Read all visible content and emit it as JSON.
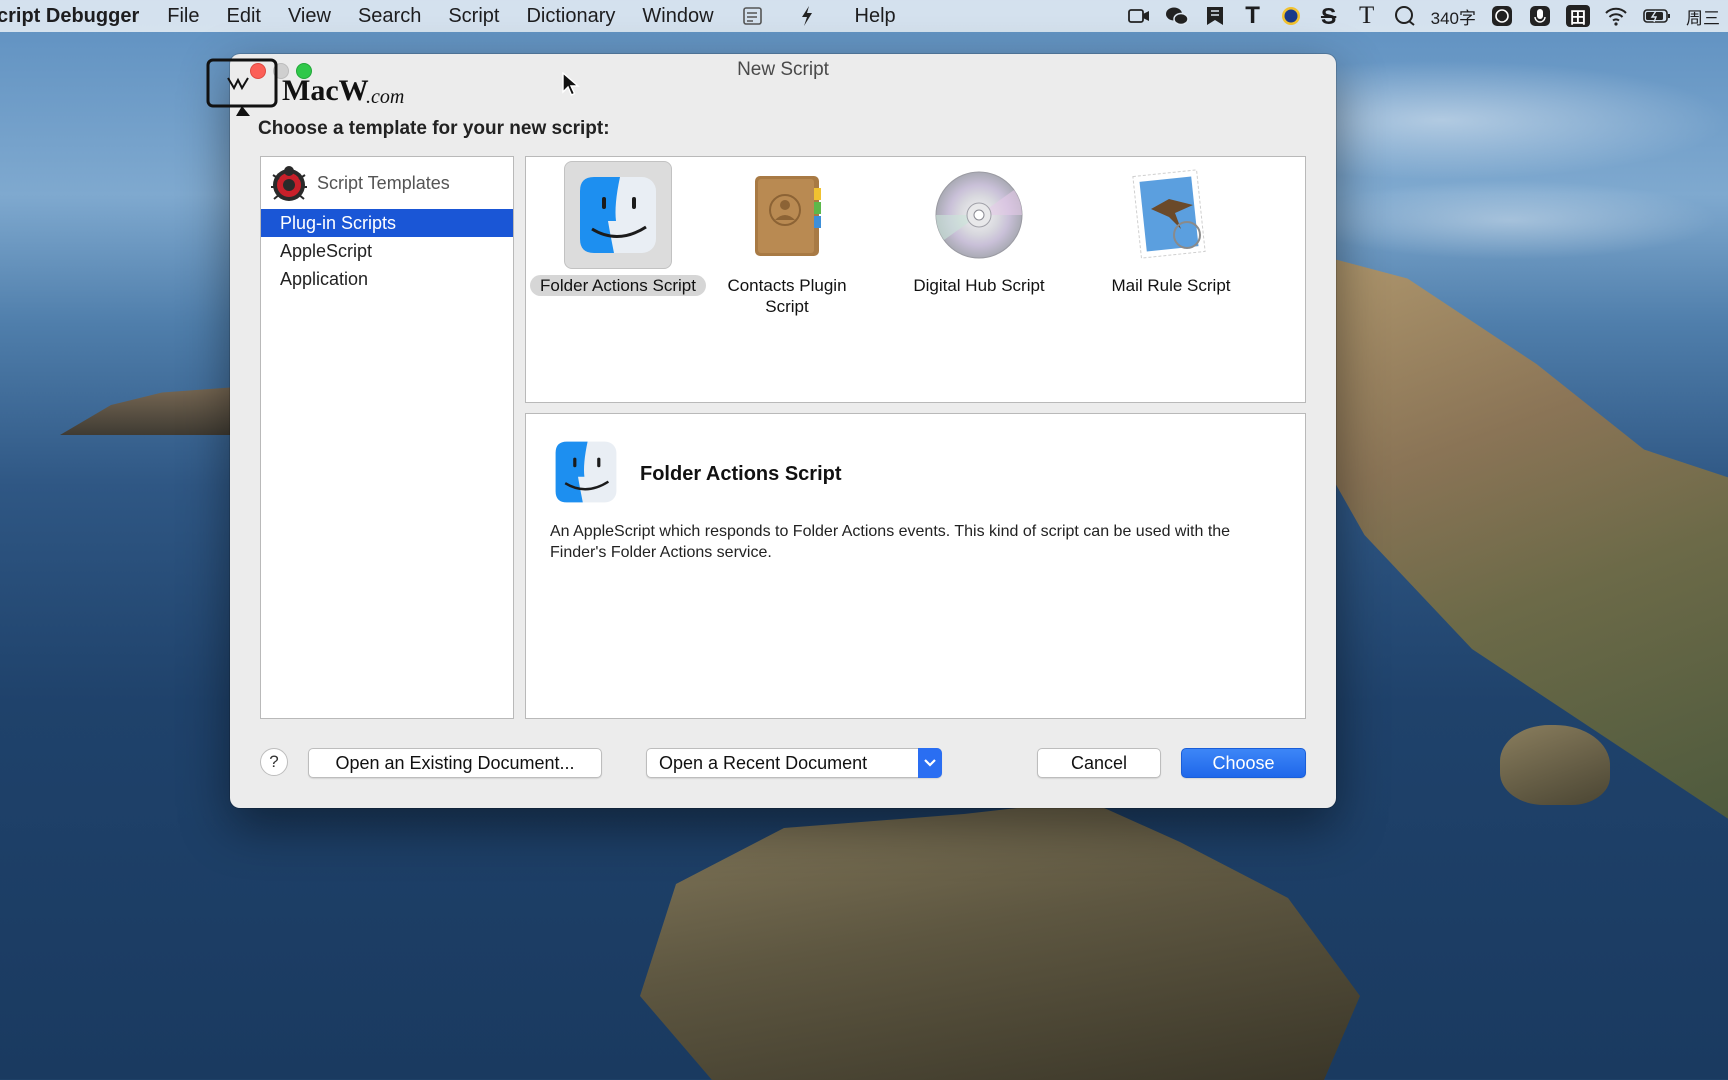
{
  "menubar": {
    "app_name": "cript Debugger",
    "items": [
      "File",
      "Edit",
      "View",
      "Search",
      "Script",
      "Dictionary",
      "Window",
      "Help"
    ],
    "status": {
      "t_letter": "T",
      "s_letter": "S",
      "t_serif": "T",
      "word_count": "340字",
      "ime_char": "田",
      "day": "周三"
    }
  },
  "watermark": {
    "brand": "MacW",
    "domain": ".com"
  },
  "dialog": {
    "title": "New Script",
    "prompt": "Choose a template for your new script:",
    "sidebar": {
      "header": "Script Templates",
      "items": [
        {
          "label": "Plug-in Scripts",
          "selected": true
        },
        {
          "label": "AppleScript",
          "selected": false
        },
        {
          "label": "Application",
          "selected": false
        }
      ]
    },
    "templates": [
      {
        "label": "Folder Actions Script",
        "icon": "finder-icon",
        "selected": true
      },
      {
        "label": "Contacts Plugin Script",
        "icon": "contacts-book-icon",
        "selected": false
      },
      {
        "label": "Digital Hub Script",
        "icon": "dvd-disc-icon",
        "selected": false
      },
      {
        "label": "Mail Rule Script",
        "icon": "mail-stamp-icon",
        "selected": false
      }
    ],
    "detail": {
      "title": "Folder Actions Script",
      "description": "An AppleScript which responds to Folder Actions events.  This kind of script can be used with the Finder's Folder Actions service."
    },
    "footer": {
      "help": "?",
      "open_existing": "Open an Existing Document...",
      "open_recent": "Open a Recent Document",
      "cancel": "Cancel",
      "choose": "Choose"
    }
  },
  "colors": {
    "accent": "#1a56d6",
    "primary_button": "#2a6ef2",
    "close": "#fc5f57",
    "zoom": "#30c84a"
  }
}
